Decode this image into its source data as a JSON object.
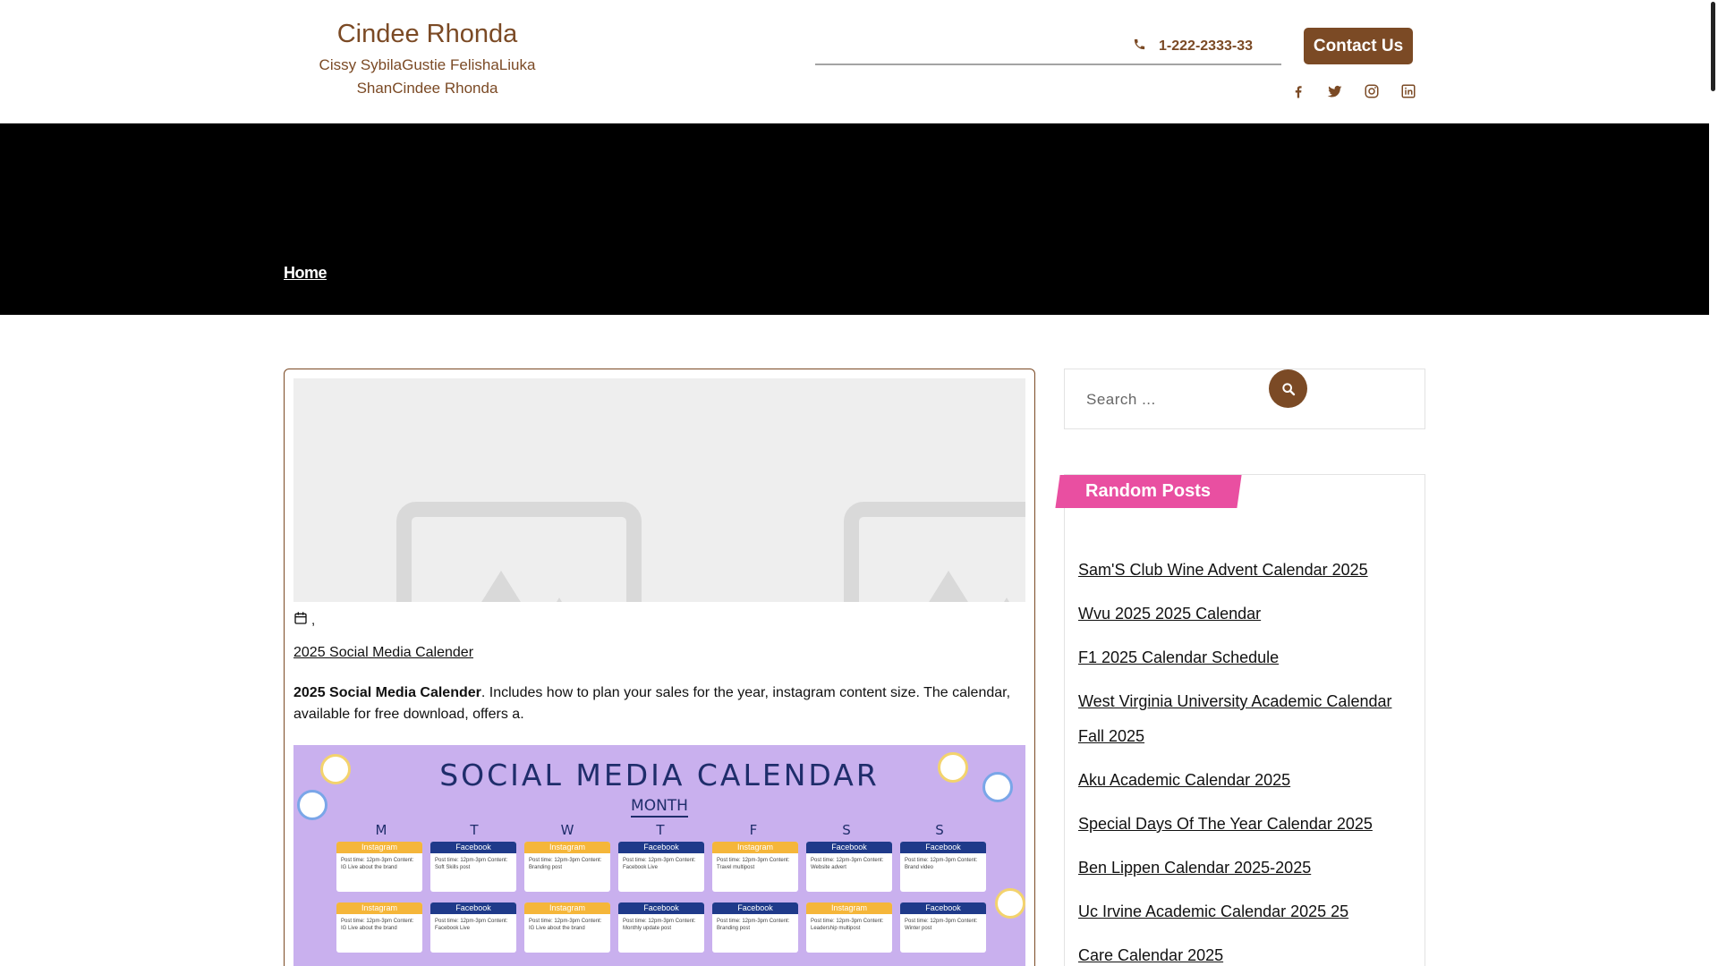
{
  "header": {
    "title": "Cindee Rhonda",
    "tagline": "Cissy SybilaGustie FelishaLiuka ShanCindee Rhonda",
    "phone": "1-222-2333-33",
    "contact_label": "Contact Us",
    "social_icons": [
      "facebook-icon",
      "twitter-icon",
      "instagram-icon",
      "linkedin-icon"
    ]
  },
  "breadcrumb": {
    "home": "Home"
  },
  "post": {
    "meta_separator": ",",
    "link": "2025 Social Media Calender",
    "excerpt_bold": "2025 Social Media Calender",
    "excerpt_rest": ". Includes how to plan your sales for the year, instagram content size. The calendar, available for free download, offers a."
  },
  "calendar_image": {
    "title": "SOCIAL MEDIA CALENDAR",
    "month": "MONTH",
    "days": [
      "M",
      "T",
      "W",
      "T",
      "F",
      "S",
      "S"
    ],
    "rows": [
      [
        {
          "type": "insta",
          "label": "Instagram",
          "text": "Post time: 12pm-3pm Content: IG Live about the brand"
        },
        {
          "type": "fb",
          "label": "Facebook",
          "text": "Post time: 12pm-3pm Content: Soft Skills post"
        },
        {
          "type": "insta",
          "label": "Instagram",
          "text": "Post time: 12pm-3pm Content: Branding post"
        },
        {
          "type": "fb",
          "label": "Facebook",
          "text": "Post time: 12pm-3pm Content: Facebook Live"
        },
        {
          "type": "insta",
          "label": "Instagram",
          "text": "Post time: 12pm-3pm Content: Travel multipost"
        },
        {
          "type": "fb",
          "label": "Facebook",
          "text": "Post time: 12pm-3pm Content: Website advert"
        },
        {
          "type": "fb",
          "label": "Facebook",
          "text": "Post time: 12pm-3pm Content: Brand video"
        }
      ],
      [
        {
          "type": "insta",
          "label": "Instagram",
          "text": "Post time: 12pm-3pm Content: IG Live about the brand"
        },
        {
          "type": "fb",
          "label": "Facebook",
          "text": "Post time: 12pm-3pm Content: Facebook Live"
        },
        {
          "type": "insta",
          "label": "Instagram",
          "text": "Post time: 12pm-3pm Content: IG Live about the brand"
        },
        {
          "type": "fb",
          "label": "Facebook",
          "text": "Post time: 12pm-3pm Content: Monthly update post"
        },
        {
          "type": "fb",
          "label": "Facebook",
          "text": "Post time: 12pm-3pm Content: Branding post"
        },
        {
          "type": "insta",
          "label": "Instagram",
          "text": "Post time: 12pm-3pm Content: Leadership multipost"
        },
        {
          "type": "fb",
          "label": "Facebook",
          "text": "Post time: 12pm-3pm Content: Winter post"
        }
      ]
    ]
  },
  "sidebar": {
    "search_placeholder": "Search ...",
    "random_title": "Random Posts",
    "random_posts": [
      "Sam'S Club Wine Advent Calendar 2025",
      "Wvu 2025 2025 Calendar",
      "F1 2025 Calendar Schedule",
      "West Virginia University Academic Calendar Fall 2025",
      "Aku Academic Calendar 2025",
      "Special Days Of The Year Calendar 2025",
      "Ben Lippen Calendar 2025-2025",
      "Uc Irvine Academic Calendar 2025 25",
      "Care Calendar 2025"
    ]
  },
  "colors": {
    "brand": "#7b4a25",
    "accent_pink": "#e94fa1",
    "banner": "#000000"
  }
}
